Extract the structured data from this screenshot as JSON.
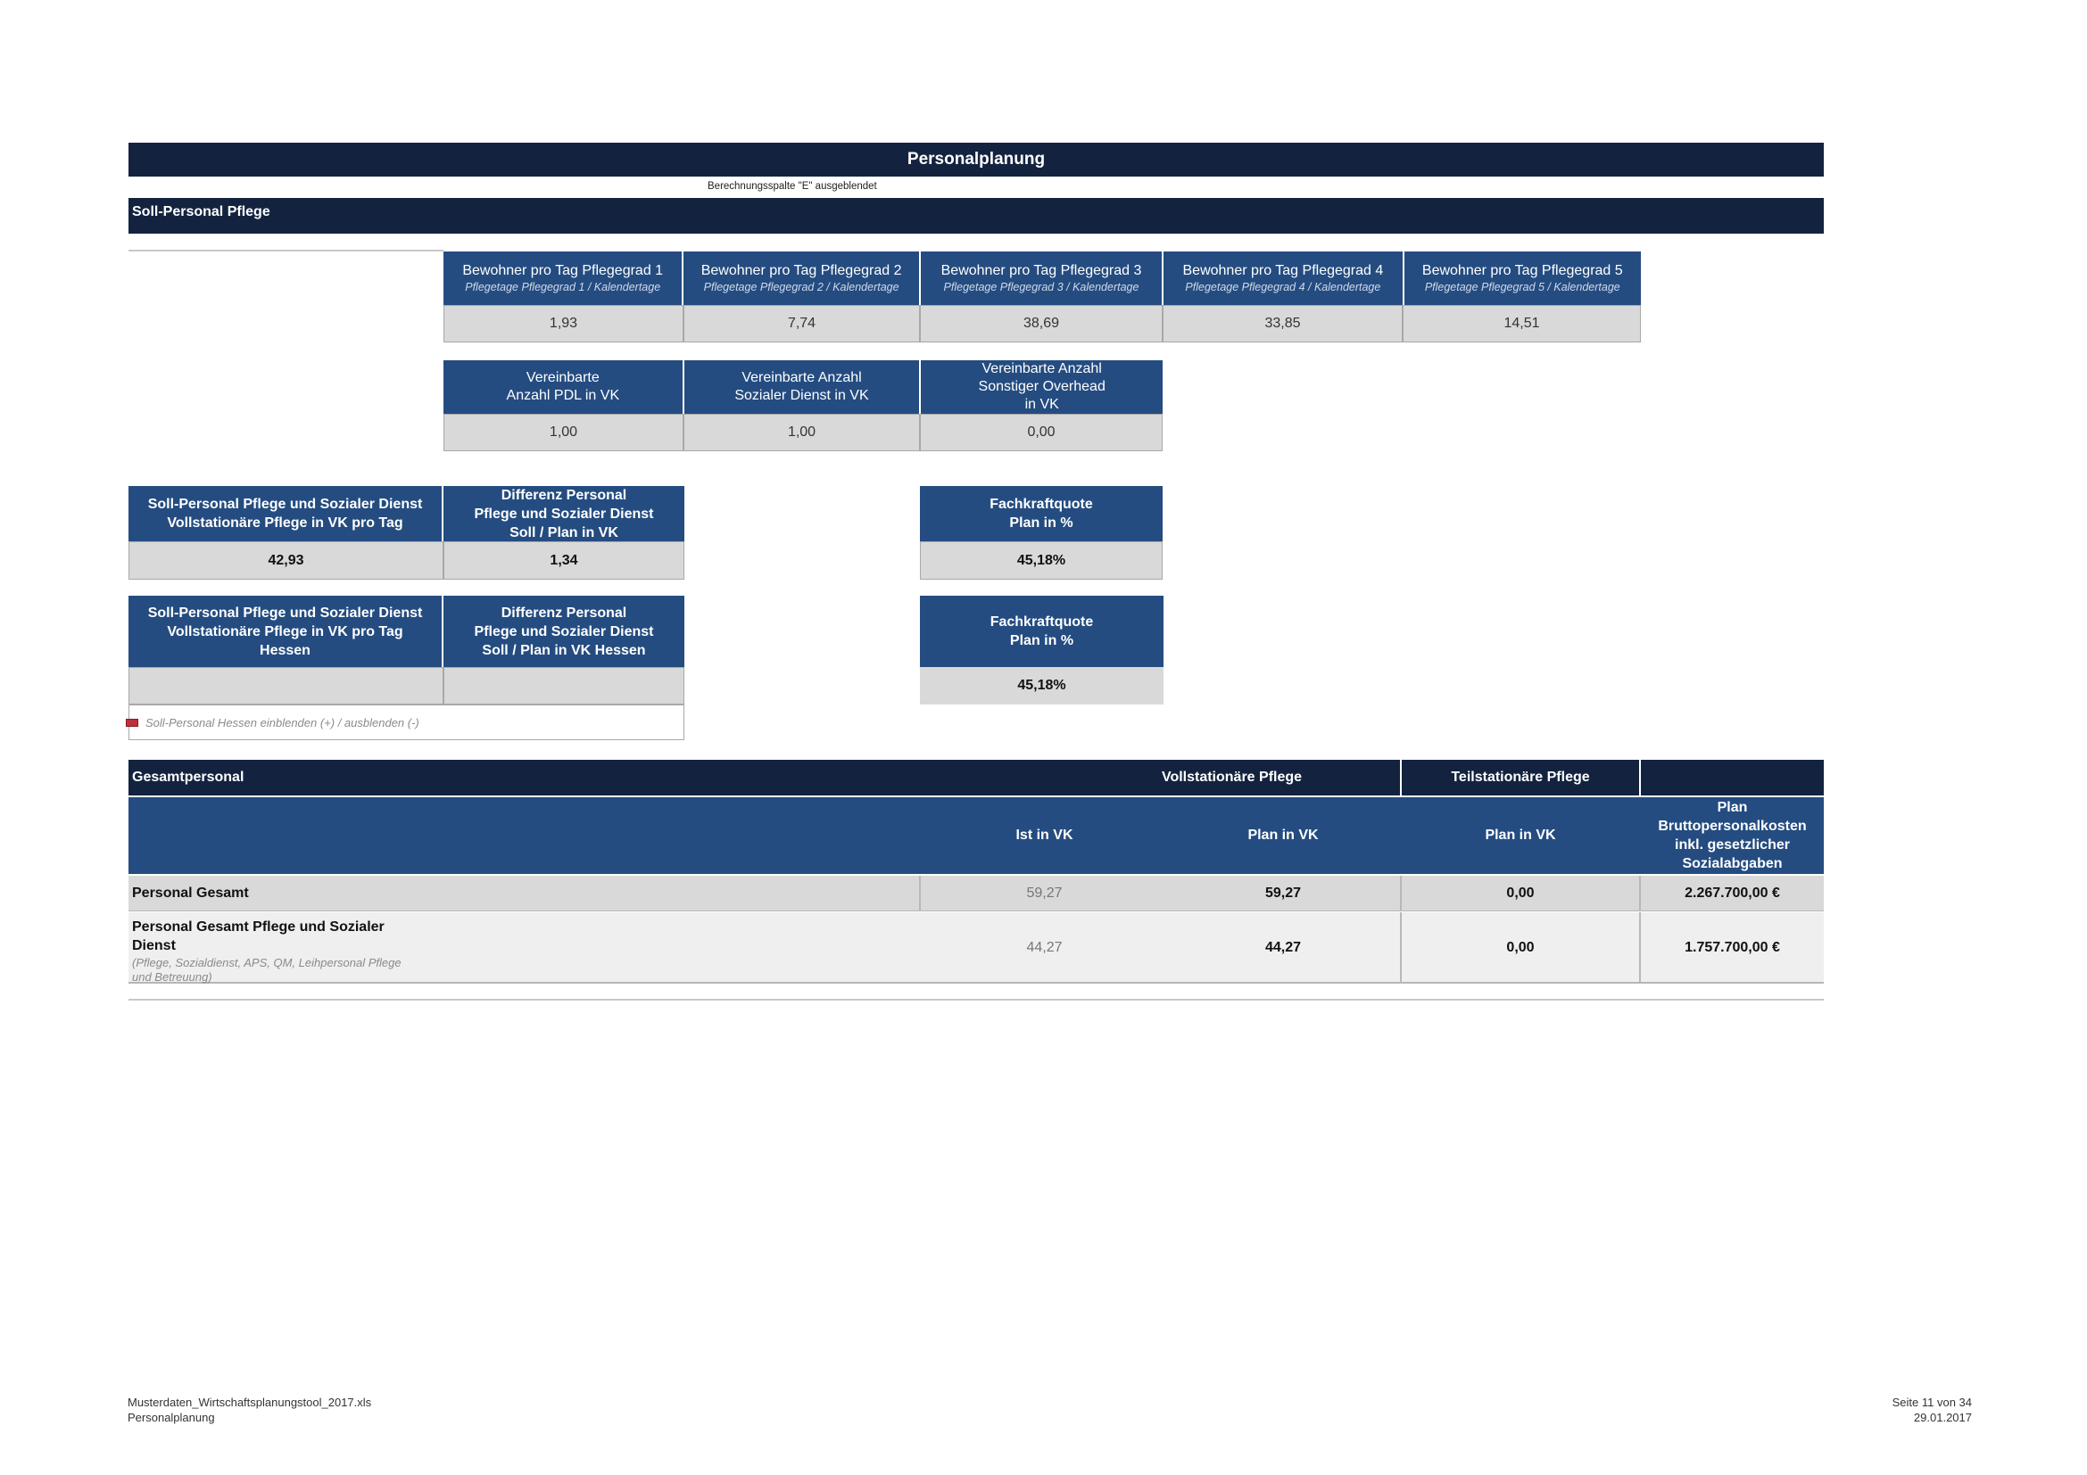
{
  "title": "Personalplanung",
  "note": "Berechnungsspalte \"E\" ausgeblendet",
  "section_title": "Soll-Personal Pflege",
  "pflegegrade": [
    {
      "label": "Bewohner pro Tag Pflegegrad 1",
      "sub": "Pflegetage Pflegegrad 1 / Kalendertage",
      "value": "1,93"
    },
    {
      "label": "Bewohner pro Tag Pflegegrad 2",
      "sub": "Pflegetage Pflegegrad 2 / Kalendertage",
      "value": "7,74"
    },
    {
      "label": "Bewohner pro Tag Pflegegrad 3",
      "sub": "Pflegetage Pflegegrad 3 / Kalendertage",
      "value": "38,69"
    },
    {
      "label": "Bewohner pro Tag Pflegegrad 4",
      "sub": "Pflegetage Pflegegrad 4 / Kalendertage",
      "value": "33,85"
    },
    {
      "label": "Bewohner pro Tag Pflegegrad 5",
      "sub": "Pflegetage Pflegegrad 5 / Kalendertage",
      "value": "14,51"
    }
  ],
  "vereinbart": [
    {
      "label": "Vereinbarte\nAnzahl PDL in VK",
      "value": "1,00"
    },
    {
      "label": "Vereinbarte Anzahl\nSozialer Dienst in VK",
      "value": "1,00"
    },
    {
      "label": "Vereinbarte Anzahl\nSonstiger Overhead\nin VK",
      "value": "0,00"
    }
  ],
  "soll_block": {
    "soll_label": "Soll-Personal Pflege und Sozialer Dienst\nVollstationäre Pflege in VK pro Tag",
    "soll_value": "42,93",
    "diff_label": "Differenz Personal\nPflege und Sozialer Dienst\nSoll / Plan in VK",
    "diff_value": "1,34",
    "fk_label": "Fachkraftquote\nPlan in %",
    "fk_value": "45,18%"
  },
  "hessen_block": {
    "soll_label": "Soll-Personal Pflege und Sozialer Dienst\nVollstationäre Pflege in VK pro Tag\nHessen",
    "soll_value": "",
    "diff_label": "Differenz Personal\nPflege und Sozialer Dienst\nSoll / Plan in VK Hessen",
    "diff_value": "",
    "fk_label": "Fachkraftquote\nPlan in %",
    "fk_value": "45,18%",
    "toggle_text": "Soll-Personal Hessen einblenden (+) / ausblenden (-)"
  },
  "gesamt": {
    "header": "Gesamtpersonal",
    "group_voll": "Vollstationäre Pflege",
    "group_teil": "Teilstationäre Pflege",
    "col_ist": "Ist in VK",
    "col_plan": "Plan in VK",
    "col_teil_plan": "Plan in VK",
    "col_kosten": "Plan\nBruttopersonalkosten\ninkl. gesetzlicher\nSozialabgaben",
    "rows": [
      {
        "label": "Personal Gesamt",
        "sub": "",
        "ist": "59,27",
        "plan": "59,27",
        "teil": "0,00",
        "kosten": "2.267.700,00 €"
      },
      {
        "label": "Personal Gesamt Pflege und Sozialer\nDienst",
        "sub": "(Pflege, Sozialdienst, APS, QM, Leihpersonal Pflege\nund Betreuung)",
        "ist": "44,27",
        "plan": "44,27",
        "teil": "0,00",
        "kosten": "1.757.700,00 €"
      }
    ]
  },
  "footer": {
    "file": "Musterdaten_Wirtschaftsplanungstool_2017.xls",
    "sheet": "Personalplanung",
    "page": "Seite 11 von 34",
    "date": "29.01.2017"
  }
}
